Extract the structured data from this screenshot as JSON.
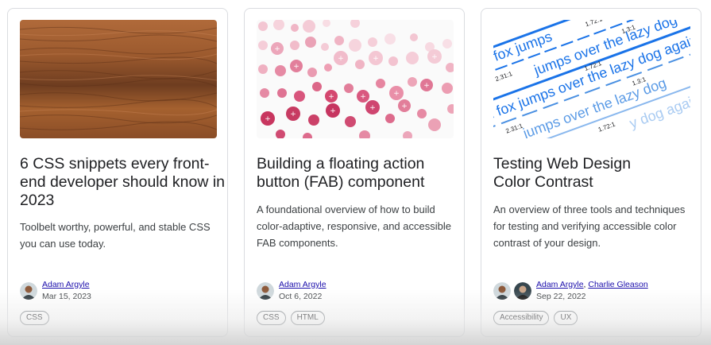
{
  "cards": [
    {
      "title": "6 CSS snippets every front-end developer should know in 2023",
      "description": "Toolbelt worthy, powerful, and stable CSS you can use today.",
      "image_icon": "wood-texture-image",
      "authors": [
        "Adam Argyle"
      ],
      "date": "Mar 15, 2023",
      "tags": [
        "CSS"
      ]
    },
    {
      "title": "Building a floating action button (FAB) component",
      "description": "A foundational overview of how to build color-adaptive, responsive, and accessible FAB components.",
      "image_icon": "fab-pattern-image",
      "authors": [
        "Adam Argyle"
      ],
      "date": "Oct 6, 2022",
      "tags": [
        "CSS",
        "HTML"
      ]
    },
    {
      "title": "Testing Web Design Color Contrast",
      "description": "An overview of three tools and techniques for testing and verifying accessible color contrast of your design.",
      "image_icon": "contrast-text-image",
      "image_text": {
        "line_a": "wn fox jumps",
        "line_b": "jumps over the lazy dog",
        "line_c": "wn fox jumps over the lazy dog again",
        "line_d": "jumps over the lazy dog",
        "line_e": "y dog again",
        "ratio_1": "1.72:1",
        "ratio_2": "2.31:1",
        "ratio_3": "1.3:1"
      },
      "authors": [
        "Adam Argyle",
        "Charlie Gleason"
      ],
      "author_separator": ",",
      "date": "Sep 22, 2022",
      "tags": [
        "Accessibility",
        "UX"
      ]
    }
  ],
  "colors": {
    "link": "#1a0dab",
    "wood": "#9a5a30",
    "fab_pink": "#c8365f",
    "contrast_blue": "#1a73e8"
  }
}
